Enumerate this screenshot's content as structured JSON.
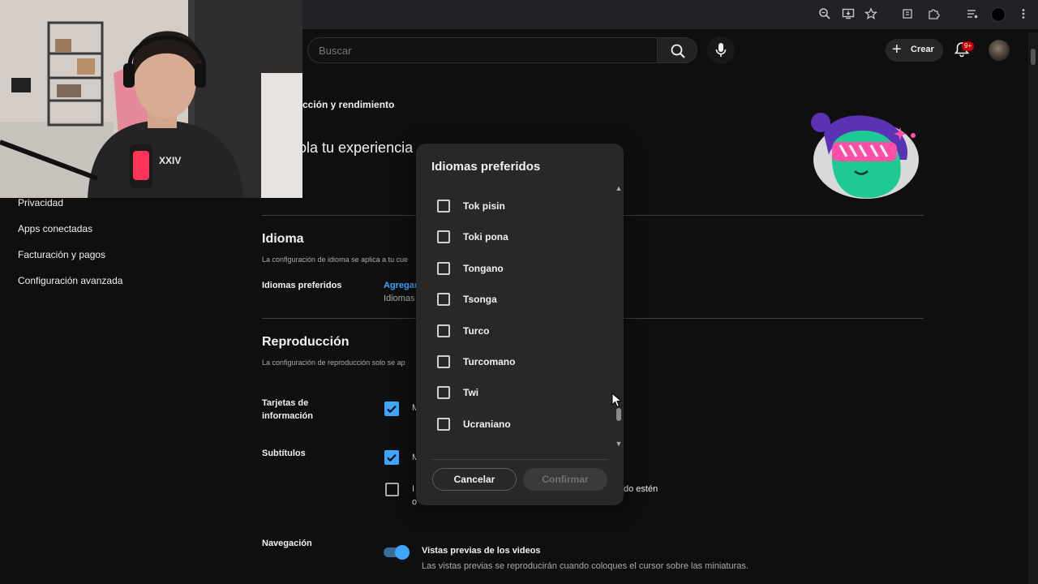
{
  "header": {
    "search_placeholder": "Buscar",
    "create_label": "Crear",
    "notification_badge": "9+"
  },
  "sidebar": {
    "items": [
      {
        "label": "Privacidad"
      },
      {
        "label": "Apps conectadas"
      },
      {
        "label": "Facturación y pagos"
      },
      {
        "label": "Configuración avanzada"
      }
    ]
  },
  "main": {
    "breadcrumb": "cción y rendimiento",
    "page_heading": "ola tu experiencia",
    "language_section": {
      "title": "Idioma",
      "description": "La configuración de idioma se aplica a tu cue",
      "preferred_label": "Idiomas preferidos",
      "add_link": "Agregar",
      "preferred_value": "Idiomas"
    },
    "playback_section": {
      "title": "Reproducción",
      "description": "La configuración de reproducción solo se ap",
      "info_cards_label": "Tarjetas de información",
      "subtitles_label": "Subtítulos",
      "info_cards_option": "M",
      "subtitles_option": "M",
      "auto_captions_line1": "I",
      "auto_captions_tail": "do estén",
      "auto_captions_line2": "o"
    },
    "navigation_section": {
      "label": "Navegación",
      "preview_title": "Vistas previas de los videos",
      "preview_description": "Las vistas previas se reproducirán cuando coloques el cursor sobre las miniaturas.",
      "preview_enabled": true
    }
  },
  "dialog": {
    "title": "Idiomas preferidos",
    "languages": [
      {
        "label": "Tok pisin",
        "checked": false
      },
      {
        "label": "Toki pona",
        "checked": false
      },
      {
        "label": "Tongano",
        "checked": false
      },
      {
        "label": "Tsonga",
        "checked": false
      },
      {
        "label": "Turco",
        "checked": false
      },
      {
        "label": "Turcomano",
        "checked": false
      },
      {
        "label": "Twi",
        "checked": false
      },
      {
        "label": "Ucraniano",
        "checked": false
      }
    ],
    "cancel_label": "Cancelar",
    "confirm_label": "Confirmar"
  },
  "colors": {
    "background": "#0f0f0f",
    "dialog_background": "#282828",
    "accent_blue": "#3ea6ff",
    "badge_red": "#cc0000"
  }
}
